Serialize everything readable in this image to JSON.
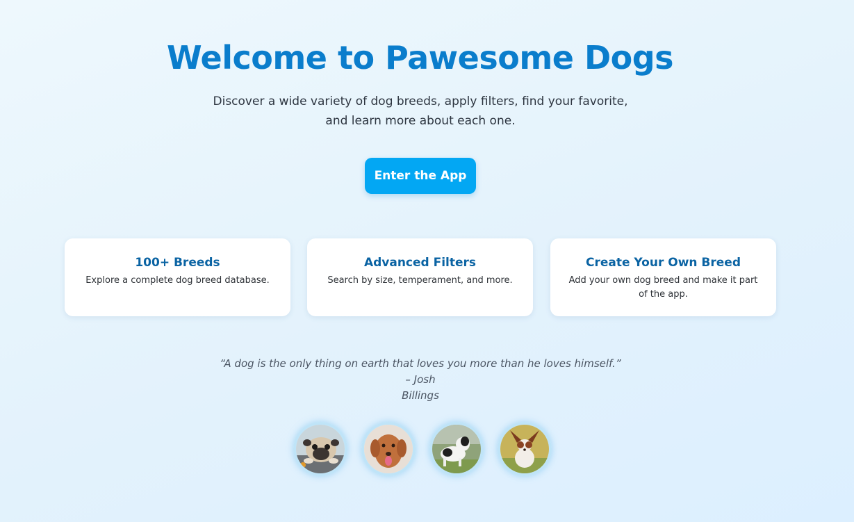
{
  "hero": {
    "title": "Welcome to Pawesome Dogs",
    "subtitle_line1": "Discover a wide variety of dog breeds, apply filters, find your favorite,",
    "subtitle_line2": "and learn more about each one.",
    "cta_label": "Enter the App"
  },
  "features": [
    {
      "title": "100+ Breeds",
      "description": "Explore a complete dog breed database."
    },
    {
      "title": "Advanced Filters",
      "description": "Search by size, temperament, and more."
    },
    {
      "title": "Create Your Own Breed",
      "description": "Add your own dog breed and make it part of the app."
    }
  ],
  "quote": {
    "line1": "“A dog is the only thing on earth that loves you more than he loves himself.” – Josh",
    "line2": "Billings"
  },
  "gallery": [
    {
      "icon": "pug-photo"
    },
    {
      "icon": "retriever-photo"
    },
    {
      "icon": "border-collie-photo"
    },
    {
      "icon": "papillon-photo"
    }
  ],
  "colors": {
    "accent": "#0a7dcc",
    "button": "#03a7f3",
    "card_title": "#0a63a3",
    "background": "#e3f2fc"
  }
}
